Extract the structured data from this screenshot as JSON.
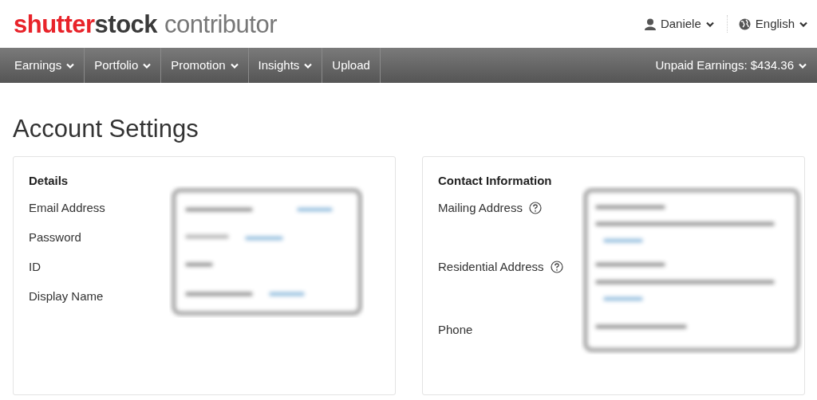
{
  "logo": {
    "brand_part_1": "shutter",
    "brand_part_2": "stock",
    "product": "contributor"
  },
  "user_menu": {
    "label": "Daniele"
  },
  "language_menu": {
    "label": "English"
  },
  "nav": {
    "items": [
      {
        "label": "Earnings",
        "dropdown": true
      },
      {
        "label": "Portfolio",
        "dropdown": true
      },
      {
        "label": "Promotion",
        "dropdown": true
      },
      {
        "label": "Insights",
        "dropdown": true
      },
      {
        "label": "Upload",
        "dropdown": false
      }
    ],
    "earnings": "Unpaid Earnings: $434.36"
  },
  "page_title": "Account Settings",
  "details": {
    "title": "Details",
    "fields": [
      {
        "label": "Email Address",
        "help": false
      },
      {
        "label": "Password",
        "help": false
      },
      {
        "label": "ID",
        "help": false
      },
      {
        "label": "Display Name",
        "help": false
      }
    ]
  },
  "contact": {
    "title": "Contact Information",
    "fields": [
      {
        "label": "Mailing Address",
        "help": true
      },
      {
        "label": "Residential Address",
        "help": true
      },
      {
        "label": "Phone",
        "help": false
      }
    ]
  }
}
